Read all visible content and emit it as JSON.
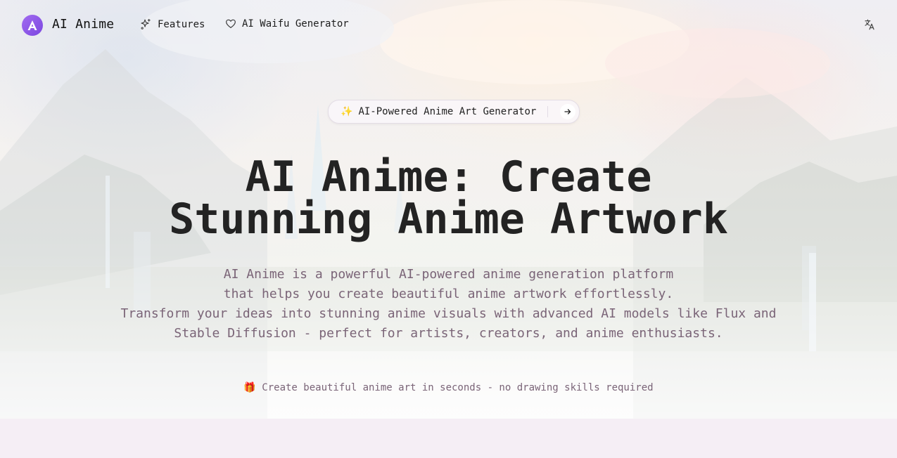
{
  "nav": {
    "brand": "AI Anime",
    "links": [
      {
        "label": "Features",
        "icon": "sparkles-icon"
      },
      {
        "label": "AI Waifu Generator",
        "icon": "heart-icon"
      }
    ],
    "language_icon": "translate-icon"
  },
  "hero": {
    "badge": {
      "emoji": "✨",
      "label": "AI-Powered Anime Art Generator",
      "icon": "arrow-right-icon"
    },
    "title_lines": [
      "AI Anime: Create",
      "Stunning Anime Artwork"
    ],
    "description_lines": [
      "AI Anime is a powerful AI-powered anime generation platform",
      "that helps you create beautiful anime artwork effortlessly.",
      "Transform your ideas into stunning anime visuals with advanced AI models like Flux and",
      "Stable Diffusion - perfect for artists, creators, and anime enthusiasts."
    ],
    "note": "🎁 Create beautiful anime art in seconds - no drawing skills required"
  },
  "colors": {
    "accent": "#8b5cf6",
    "title": "#232323",
    "muted_text": "#7a6477",
    "band": "#f5eef5"
  }
}
